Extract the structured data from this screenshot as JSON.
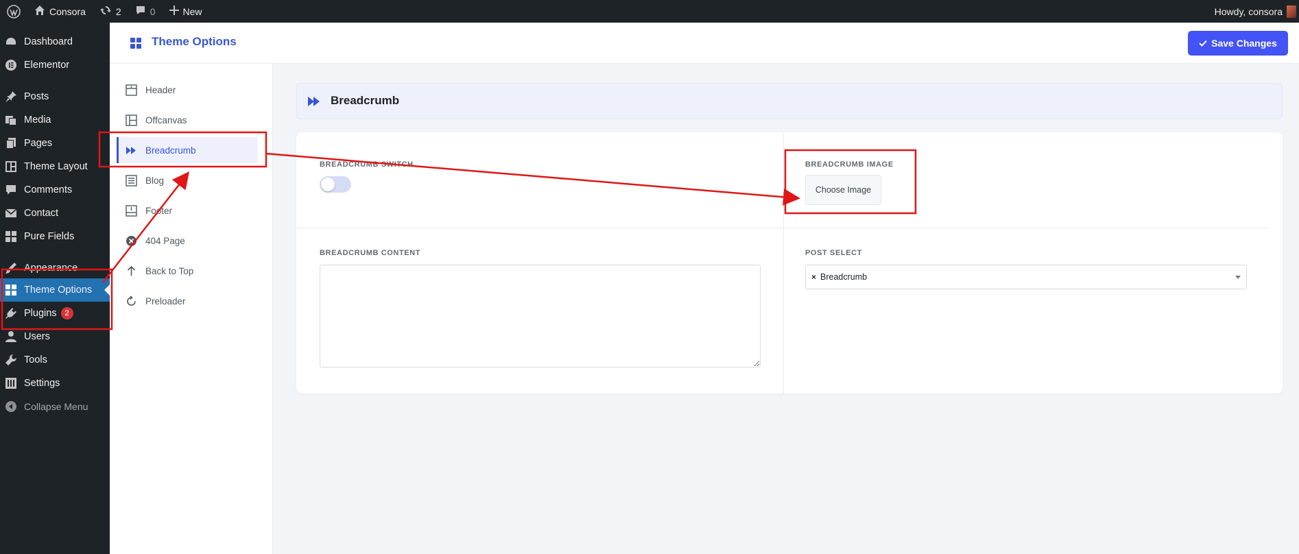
{
  "adminbar": {
    "site_name": "Consora",
    "updates_count": "2",
    "comments_count": "0",
    "new_label": "New",
    "greeting": "Howdy, consora"
  },
  "admin_menu": [
    {
      "label": "Dashboard",
      "icon": "dashboard-icon"
    },
    {
      "label": "Elementor",
      "icon": "elementor-icon"
    },
    {
      "label": "Posts",
      "icon": "pin-icon"
    },
    {
      "label": "Media",
      "icon": "media-icon"
    },
    {
      "label": "Pages",
      "icon": "pages-icon"
    },
    {
      "label": "Theme Layout",
      "icon": "layout-icon"
    },
    {
      "label": "Comments",
      "icon": "comment-icon"
    },
    {
      "label": "Contact",
      "icon": "mail-icon"
    },
    {
      "label": "Pure Fields",
      "icon": "grid-icon"
    },
    {
      "label": "Appearance",
      "icon": "brush-icon"
    },
    {
      "label": "Theme Options",
      "icon": "grid-icon",
      "current": true
    },
    {
      "label": "Plugins",
      "icon": "plug-icon",
      "badge": "2"
    },
    {
      "label": "Users",
      "icon": "user-icon"
    },
    {
      "label": "Tools",
      "icon": "wrench-icon"
    },
    {
      "label": "Settings",
      "icon": "settings-icon"
    },
    {
      "label": "Collapse Menu",
      "icon": "collapse-icon"
    }
  ],
  "header": {
    "title": "Theme Options",
    "save_label": "Save Changes"
  },
  "options_nav": [
    {
      "label": "Header",
      "icon": "header-icon"
    },
    {
      "label": "Offcanvas",
      "icon": "offcanvas-icon"
    },
    {
      "label": "Breadcrumb",
      "icon": "forward-icon",
      "active": true
    },
    {
      "label": "Blog",
      "icon": "list-icon"
    },
    {
      "label": "Footer",
      "icon": "footer-icon"
    },
    {
      "label": "404 Page",
      "icon": "error-icon"
    },
    {
      "label": "Back to Top",
      "icon": "arrow-up-icon"
    },
    {
      "label": "Preloader",
      "icon": "refresh-icon"
    }
  ],
  "section": {
    "title": "Breadcrumb",
    "fields": {
      "switch_label": "BREADCRUMB SWITCH",
      "switch_on": false,
      "image_label": "BREADCRUMB IMAGE",
      "choose_image_label": "Choose Image",
      "content_label": "BREADCRUMB CONTENT",
      "content_value": "",
      "post_select_label": "POST SELECT",
      "post_select_value": "Breadcrumb"
    }
  },
  "colors": {
    "accent": "#3a56d4",
    "save_button": "#4353f5",
    "admin_dark": "#1d2327",
    "admin_current": "#2271b1",
    "annotation": "#e01616"
  }
}
